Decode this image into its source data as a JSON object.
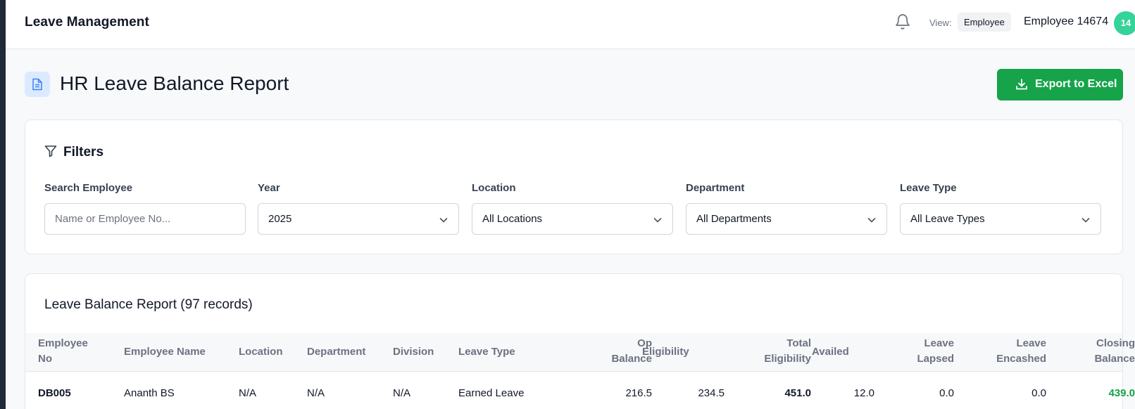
{
  "app": {
    "title": "Leave Management"
  },
  "topbar": {
    "view_label": "View:",
    "view_value": "Employee",
    "user_name": "Employee 14674",
    "avatar_text": "14"
  },
  "page": {
    "title": "HR Leave Balance Report",
    "export_label": "Export to Excel"
  },
  "filters": {
    "title": "Filters",
    "search": {
      "label": "Search Employee",
      "placeholder": "Name or Employee No...",
      "value": ""
    },
    "year": {
      "label": "Year",
      "value": "2025"
    },
    "location": {
      "label": "Location",
      "value": "All Locations"
    },
    "department": {
      "label": "Department",
      "value": "All Departments"
    },
    "leave_type": {
      "label": "Leave Type",
      "value": "All Leave Types"
    }
  },
  "report": {
    "title": "Leave Balance Report (97 records)",
    "columns": [
      {
        "line1": "Employee",
        "line2": "No"
      },
      {
        "line1": "Employee Name",
        "line2": ""
      },
      {
        "line1": "Location",
        "line2": ""
      },
      {
        "line1": "Department",
        "line2": ""
      },
      {
        "line1": "Division",
        "line2": ""
      },
      {
        "line1": "Leave Type",
        "line2": ""
      },
      {
        "line1": "Op",
        "line2": "Balance"
      },
      {
        "line1": "Eligibility",
        "line2": ""
      },
      {
        "line1": "Total",
        "line2": "Eligibility"
      },
      {
        "line1": "Availed",
        "line2": ""
      },
      {
        "line1": "Leave",
        "line2": "Lapsed"
      },
      {
        "line1": "Leave",
        "line2": "Encashed"
      },
      {
        "line1": "Closing",
        "line2": "Balance"
      }
    ],
    "rows": [
      {
        "employee_no": "DB005",
        "employee_name": "Ananth BS",
        "location": "N/A",
        "department": "N/A",
        "division": "N/A",
        "leave_type": "Earned Leave",
        "op_balance": "216.5",
        "eligibility": "234.5",
        "total_eligibility": "451.0",
        "availed": "12.0",
        "leave_lapsed": "0.0",
        "leave_encashed": "0.0",
        "closing_balance": "439.0"
      }
    ]
  },
  "colors": {
    "accent_green": "#16a34a",
    "avatar_green": "#34d399",
    "icon_bg_blue": "#dbeafe",
    "icon_blue": "#3b82f6"
  }
}
